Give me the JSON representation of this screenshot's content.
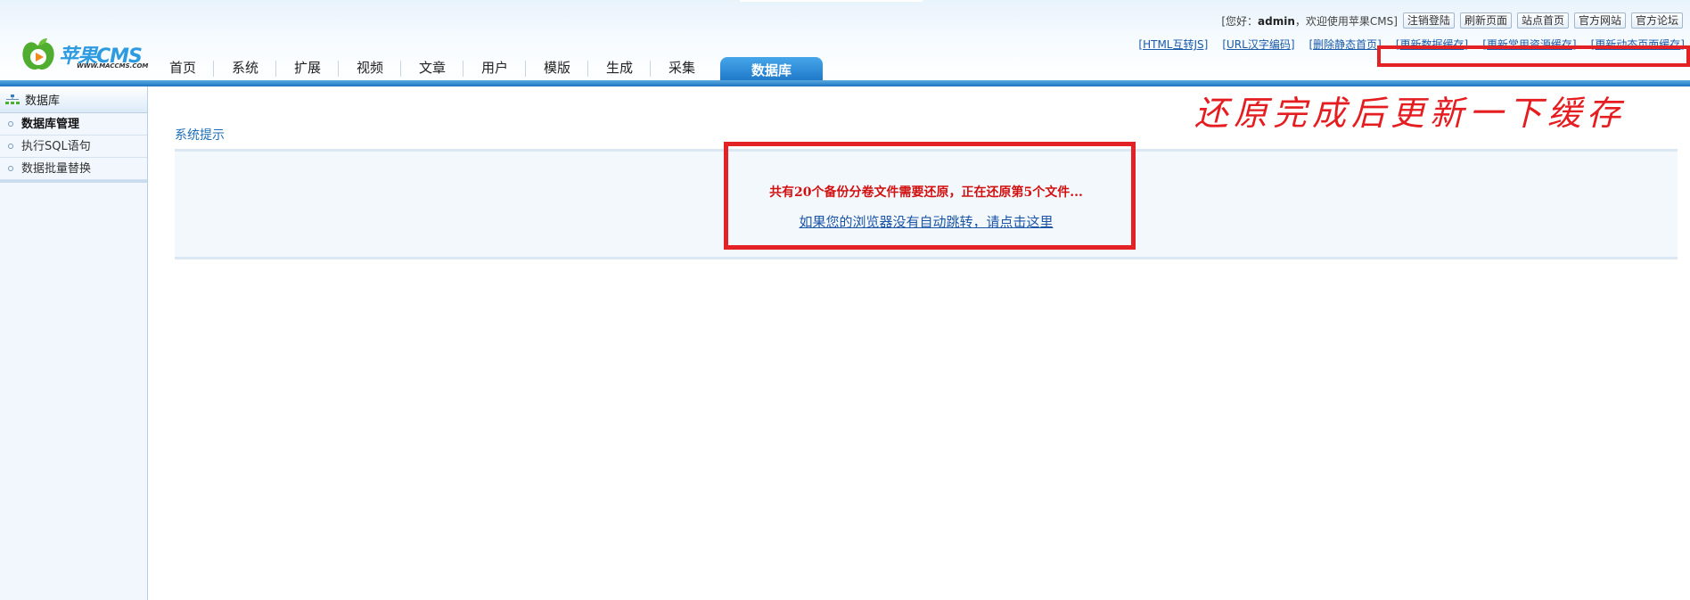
{
  "header": {
    "logo": {
      "brand": "苹果CMS",
      "url": "WWW.MACCMS.COM"
    },
    "nav": [
      {
        "label": "首页"
      },
      {
        "label": "系统"
      },
      {
        "label": "扩展"
      },
      {
        "label": "视频"
      },
      {
        "label": "文章"
      },
      {
        "label": "用户"
      },
      {
        "label": "模版"
      },
      {
        "label": "生成"
      },
      {
        "label": "采集"
      },
      {
        "label": "数据库",
        "active": true
      }
    ],
    "greeting": {
      "prefix": "[您好：",
      "user": "admin",
      "suffix": "，欢迎使用苹果CMS]"
    },
    "top_buttons": [
      "注销登陆",
      "刷新页面",
      "站点首页",
      "官方网站",
      "官方论坛"
    ],
    "quick_links": [
      "[HTML互转JS]",
      "[URL汉字编码]",
      "[删除静态首页]",
      "[更新数据缓存]",
      "[更新常用资源缓存]",
      "[更新动态页面缓存]"
    ]
  },
  "annotation": {
    "text": "还原完成后更新一下缓存",
    "color": "#e51d20"
  },
  "sidebar": {
    "title": "数据库",
    "items": [
      {
        "label": "数据库管理",
        "active": true
      },
      {
        "label": "执行SQL语句"
      },
      {
        "label": "数据批量替换"
      }
    ]
  },
  "main": {
    "title": "系统提示",
    "message": "共有20个备份分卷文件需要还原，正在还原第5个文件...",
    "redirect_link": "如果您的浏览器没有自动跳转，请点击这里"
  },
  "colors": {
    "accent": "#1a73c4",
    "alert": "#d21010",
    "annotation_border": "#e32226"
  }
}
